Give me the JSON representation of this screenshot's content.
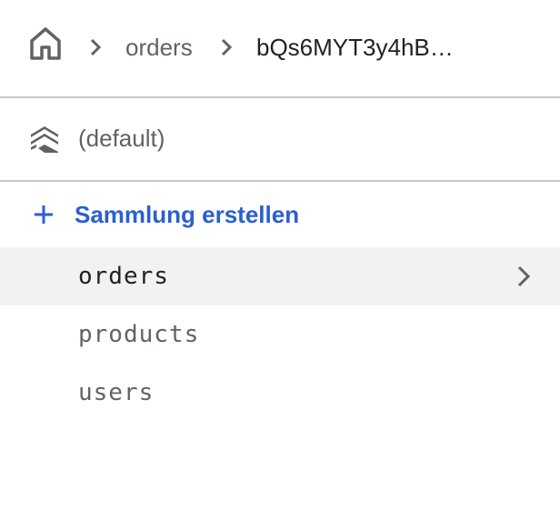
{
  "breadcrumb": {
    "home_icon": "home-icon",
    "separator_icon": "chevron-right-icon",
    "items": [
      "orders",
      "bQs6MYT3y4hB…"
    ]
  },
  "database": {
    "icon": "database-stack-icon",
    "label": "(default)"
  },
  "create_collection": {
    "icon": "plus-icon",
    "label": "Sammlung erstellen"
  },
  "collections": [
    {
      "label": "orders",
      "selected": true
    },
    {
      "label": "products",
      "selected": false
    },
    {
      "label": "users",
      "selected": false
    }
  ],
  "colors": {
    "accent": "#2b5fd0",
    "selected_bg": "#f2f2f2",
    "divider": "#c8c8c8",
    "text_primary": "#202124",
    "text_secondary": "#5f6368"
  }
}
